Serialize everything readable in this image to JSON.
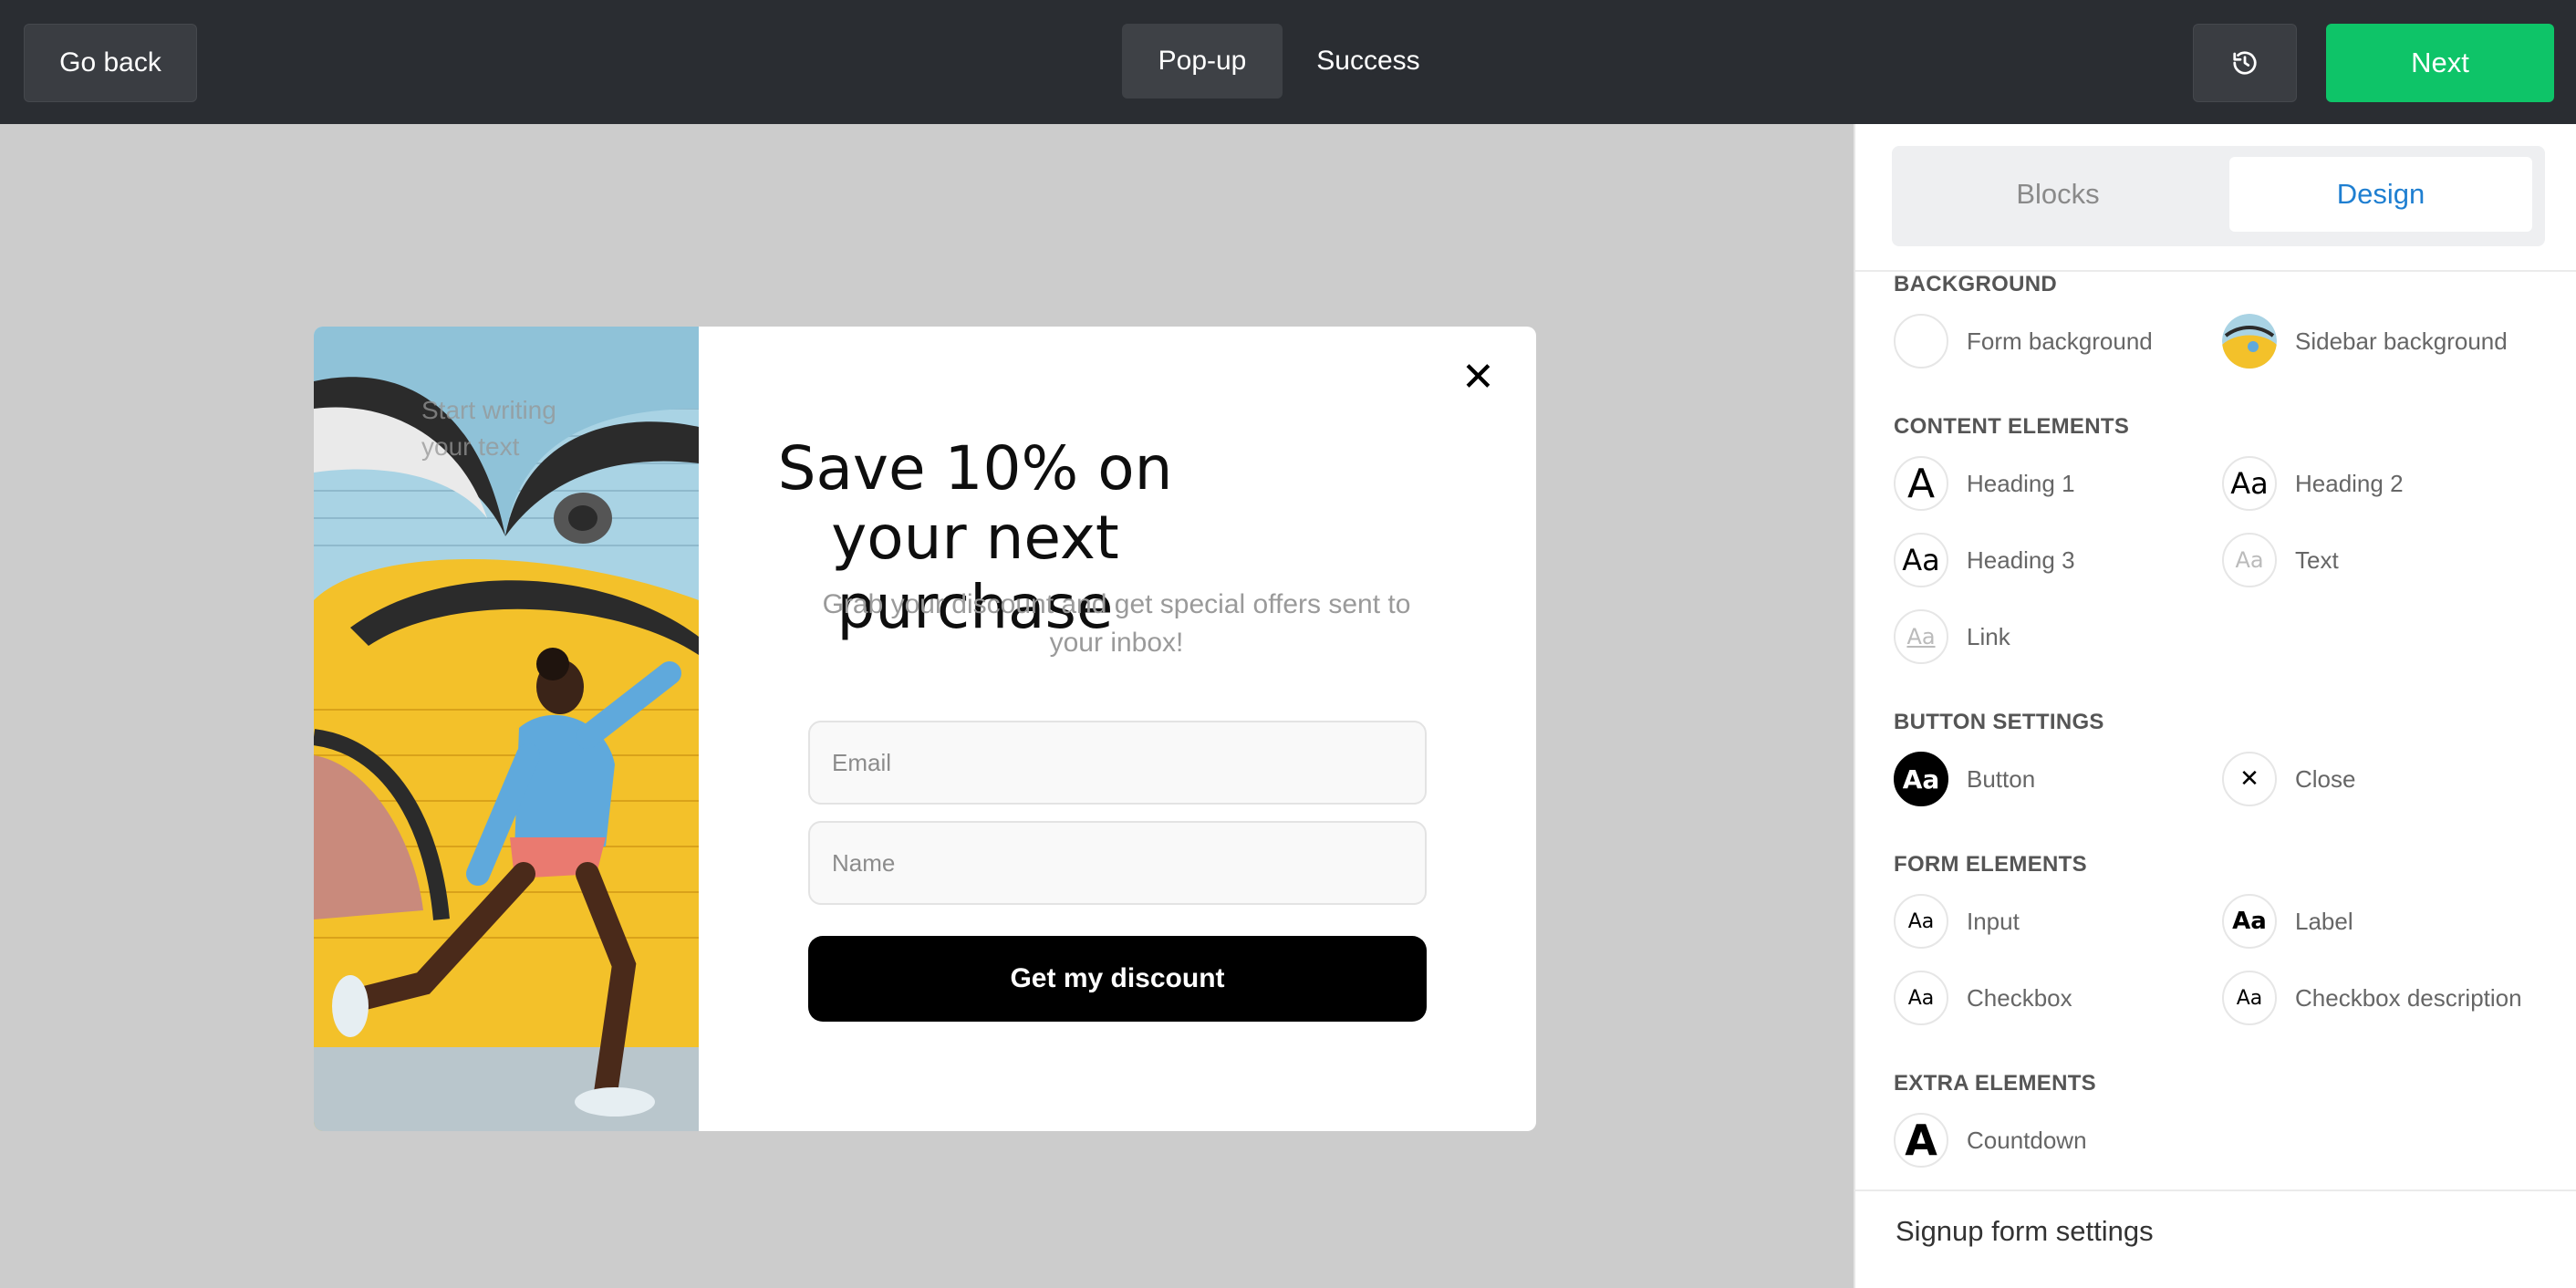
{
  "topbar": {
    "go_back": "Go back",
    "tabs": [
      "Pop-up",
      "Success"
    ],
    "history_icon": "history-icon",
    "next": "Next",
    "colors": {
      "bar": "#2a2d32",
      "next": "#0ec468"
    }
  },
  "popup": {
    "image_overlay_text": "Start writing your text",
    "title": "Save 10% on your next purchase",
    "subtitle": "Grab your discount and get special offers sent to your inbox!",
    "email_placeholder": "Email",
    "name_placeholder": "Name",
    "cta": "Get my discount",
    "close_icon": "close-icon"
  },
  "panel": {
    "tabs": {
      "blocks": "Blocks",
      "design": "Design",
      "active": "Design"
    },
    "sections": {
      "background": {
        "title": "BACKGROUND",
        "items": [
          {
            "label": "Form background",
            "icon": "form-background-swatch"
          },
          {
            "label": "Sidebar background",
            "icon": "sidebar-background-thumbnail"
          }
        ]
      },
      "content": {
        "title": "CONTENT ELEMENTS",
        "items": [
          {
            "label": "Heading 1",
            "glyph": "A"
          },
          {
            "label": "Heading 2",
            "glyph": "Aa"
          },
          {
            "label": "Heading 3",
            "glyph": "Aa"
          },
          {
            "label": "Text",
            "glyph": "Aa"
          },
          {
            "label": "Link",
            "glyph": "Aa"
          }
        ]
      },
      "button": {
        "title": "BUTTON SETTINGS",
        "items": [
          {
            "label": "Button",
            "glyph": "Aa"
          },
          {
            "label": "Close",
            "glyph": "✕"
          }
        ]
      },
      "form": {
        "title": "FORM ELEMENTS",
        "items": [
          {
            "label": "Input",
            "glyph": "Aa"
          },
          {
            "label": "Label",
            "glyph": "Aa"
          },
          {
            "label": "Checkbox",
            "glyph": "Aa"
          },
          {
            "label": "Checkbox description",
            "glyph": "Aa"
          }
        ]
      },
      "extra": {
        "title": "EXTRA ELEMENTS",
        "items": [
          {
            "label": "Countdown",
            "glyph": "A"
          }
        ]
      }
    },
    "signup_settings": "Signup form settings",
    "colors": {
      "accent": "#1f7fd1"
    }
  }
}
